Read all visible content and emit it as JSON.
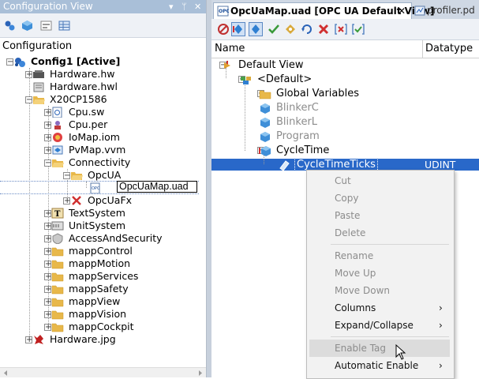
{
  "left_pane": {
    "title": "Configuration View",
    "title_controls": [
      "▾",
      "ᛘ",
      "✕"
    ],
    "root_label": "Configuration",
    "tree": [
      {
        "label": "Config1 [Active]",
        "icon": "config-icon",
        "bold": true
      },
      {
        "label": "Hardware.hw",
        "icon": "hardware-icon"
      },
      {
        "label": "Hardware.hwl",
        "icon": "hardware-list-icon"
      },
      {
        "label": "X20CP1586",
        "icon": "folder-open-icon"
      },
      {
        "label": "Cpu.sw",
        "icon": "software-config-icon"
      },
      {
        "label": "Cpu.per",
        "icon": "permissions-icon"
      },
      {
        "label": "IoMap.iom",
        "icon": "iomap-icon"
      },
      {
        "label": "PvMap.vvm",
        "icon": "pvmap-icon"
      },
      {
        "label": "Connectivity",
        "icon": "folder-open-icon"
      },
      {
        "label": "OpcUA",
        "icon": "folder-open-icon"
      },
      {
        "label": "OpcUaMap.uad",
        "icon": "opc-file-icon",
        "editing": true
      },
      {
        "label": "OpcUaFx",
        "icon": "opcuafx-icon"
      },
      {
        "label": "TextSystem",
        "icon": "textsystem-icon"
      },
      {
        "label": "UnitSystem",
        "icon": "unitsystem-icon"
      },
      {
        "label": "AccessAndSecurity",
        "icon": "security-icon"
      },
      {
        "label": "mappControl",
        "icon": "folder-icon"
      },
      {
        "label": "mappMotion",
        "icon": "folder-icon"
      },
      {
        "label": "mappServices",
        "icon": "folder-icon"
      },
      {
        "label": "mappSafety",
        "icon": "folder-icon"
      },
      {
        "label": "mappView",
        "icon": "folder-icon"
      },
      {
        "label": "mappVision",
        "icon": "folder-icon"
      },
      {
        "label": "mappCockpit",
        "icon": "folder-icon"
      },
      {
        "label": "Hardware.jpg",
        "icon": "image-icon"
      }
    ]
  },
  "right_pane": {
    "tabs": [
      {
        "label": "OpcUaMap.uad [OPC UA Default View]",
        "active": true
      },
      {
        "label": "profiler.pd",
        "active": false
      }
    ],
    "columns": [
      "Name",
      "Datatype"
    ],
    "tree": [
      {
        "label": "Default View",
        "enabled": true
      },
      {
        "label": "<Default>",
        "enabled": true
      },
      {
        "label": "Global Variables",
        "enabled": true
      },
      {
        "label": "BlinkerC",
        "enabled": false
      },
      {
        "label": "BlinkerL",
        "enabled": false
      },
      {
        "label": "Program",
        "enabled": false
      },
      {
        "label": "CycleTime",
        "enabled": true
      },
      {
        "label": "CycleTimeTicks",
        "enabled": true,
        "selected": true,
        "datatype": "UDINT"
      }
    ]
  },
  "context_menu": {
    "items": [
      {
        "label": "Cut",
        "enabled": false
      },
      {
        "label": "Copy",
        "enabled": false
      },
      {
        "label": "Paste",
        "enabled": false
      },
      {
        "label": "Delete",
        "enabled": false
      },
      {
        "label": "Rename",
        "enabled": false
      },
      {
        "label": "Move Up",
        "enabled": false
      },
      {
        "label": "Move Down",
        "enabled": false
      },
      {
        "label": "Columns",
        "enabled": true,
        "submenu": true
      },
      {
        "label": "Expand/Collapse",
        "enabled": true,
        "submenu": true
      },
      {
        "label": "Enable Tag",
        "enabled": false,
        "hovered": true
      },
      {
        "label": "Automatic Enable",
        "enabled": true,
        "submenu": true
      }
    ],
    "submenu_arrow": "›"
  },
  "colors": {
    "title_bar": "#a9bfd8",
    "selection": "#2968c9",
    "folder": "#e8b84a",
    "disabled_text": "#8c8c8c"
  }
}
